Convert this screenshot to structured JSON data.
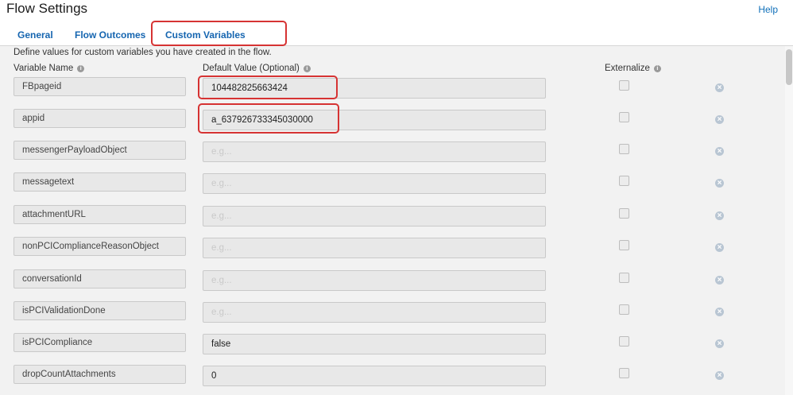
{
  "header": {
    "title": "Flow Settings",
    "help_label": "Help",
    "tabs": [
      {
        "label": "General"
      },
      {
        "label": "Flow Outcomes"
      },
      {
        "label": "Custom Variables",
        "active": true
      }
    ]
  },
  "main": {
    "description": "Define values for custom variables you have created in the flow.",
    "columns": {
      "variable_name": "Variable Name",
      "default_value": "Default Value (Optional)",
      "externalize": "Externalize"
    },
    "placeholder": "e.g...",
    "rows": [
      {
        "name": "FBpageid",
        "value": "104482825663424",
        "externalize": false
      },
      {
        "name": "appid",
        "value": "a_637926733345030000",
        "externalize": false
      },
      {
        "name": "messengerPayloadObject",
        "value": "",
        "externalize": false
      },
      {
        "name": "messagetext",
        "value": "",
        "externalize": false
      },
      {
        "name": "attachmentURL",
        "value": "",
        "externalize": false
      },
      {
        "name": "nonPCIComplianceReasonObject",
        "value": "",
        "externalize": false
      },
      {
        "name": "conversationId",
        "value": "",
        "externalize": false
      },
      {
        "name": "isPCIValidationDone",
        "value": "",
        "externalize": false
      },
      {
        "name": "isPCICompliance",
        "value": "false",
        "externalize": false
      },
      {
        "name": "dropCountAttachments",
        "value": "0",
        "externalize": false
      }
    ]
  },
  "colors": {
    "link": "#1565b0",
    "highlight": "#d63333",
    "panel_bg": "#f2f2f2"
  },
  "icons": {
    "info": "info-icon",
    "delete": "remove-circle-icon"
  }
}
